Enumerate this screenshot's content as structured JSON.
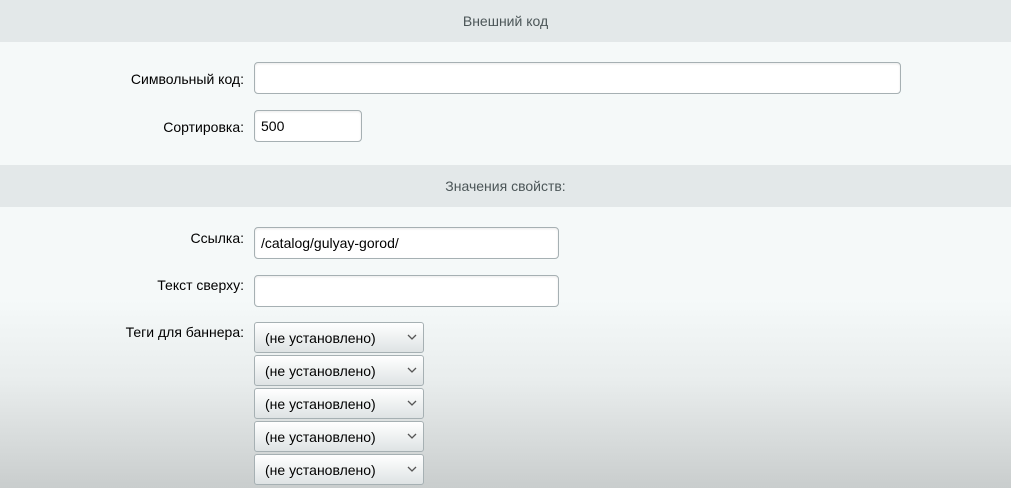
{
  "sections": {
    "external_code": "Внешний код",
    "properties": "Значения свойств:"
  },
  "fields": {
    "symbolic_code": {
      "label": "Символьный код:",
      "value": ""
    },
    "sort": {
      "label": "Сортировка:",
      "value": "500"
    },
    "link": {
      "label": "Ссылка:",
      "value": "/catalog/gulyay-gorod/"
    },
    "top_text": {
      "label": "Текст сверху:",
      "value": ""
    },
    "banner_tags": {
      "label": "Теги для баннера:",
      "options": [
        "(не установлено)",
        "(не установлено)",
        "(не установлено)",
        "(не установлено)",
        "(не установлено)"
      ]
    }
  }
}
